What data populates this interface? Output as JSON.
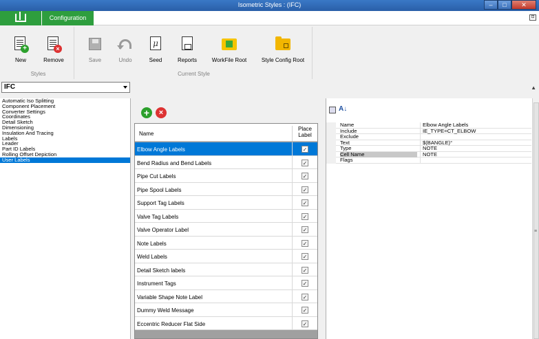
{
  "window": {
    "title": "Isometric Styles : (IFC)",
    "minimize": "–",
    "maximize": "□",
    "close": "✕"
  },
  "tabs": {
    "configuration": "Configuration",
    "collapse": "⊡"
  },
  "ribbon": {
    "styles_group": {
      "label": "Styles",
      "new": "New",
      "remove": "Remove"
    },
    "current_style_group": {
      "label": "Current Style",
      "save": "Save",
      "undo": "Undo",
      "seed": "Seed",
      "reports": "Reports",
      "workfile_root": "WorkFile Root",
      "style_config_root": "Style Config Root"
    }
  },
  "style_selector": {
    "value": "IFC"
  },
  "categories": [
    "Automatic Iso Splitting",
    "Component Placement",
    "Converter Settings",
    "Coordinates",
    "Detail Sketch",
    "Dimensioning",
    "Insulation And Tracing",
    "Labels",
    "Leader",
    "Part ID Labels",
    "Rolling Offset Depiction",
    "User Labels"
  ],
  "selected_category": "User Labels",
  "grid": {
    "col_name": "Name",
    "col_place_label": "Place Label",
    "check_glyph": "✓",
    "rows": [
      "Elbow Angle Labels",
      "Bend Radius and Bend Labels",
      "Pipe Cut Labels",
      "Pipe Spool Labels",
      "Support Tag Labels",
      "Valve Tag Labels",
      "Valve Operator Label",
      "Note Labels",
      "Weld Labels",
      "Detail Sketch labels",
      "Instrument Tags",
      "Variable Shape Note Label",
      "Dummy Weld Message",
      "Eccentric Reducer Flat Side"
    ]
  },
  "properties": {
    "sort_glyph": "A↓",
    "rows": [
      {
        "key": "Name",
        "value": "Elbow Angle Labels"
      },
      {
        "key": "Include",
        "value": "IE_TYPE=CT_ELBOW"
      },
      {
        "key": "Exclude",
        "value": ""
      },
      {
        "key": "Text",
        "value": "$(BANGLE)°"
      },
      {
        "key": "Type",
        "value": "NOTE"
      },
      {
        "key": "Cell Name",
        "value": "NOTE"
      },
      {
        "key": "Flags",
        "value": ""
      }
    ]
  },
  "colors": {
    "accent_green": "#2e9e3e",
    "selection_blue": "#0078d7"
  }
}
